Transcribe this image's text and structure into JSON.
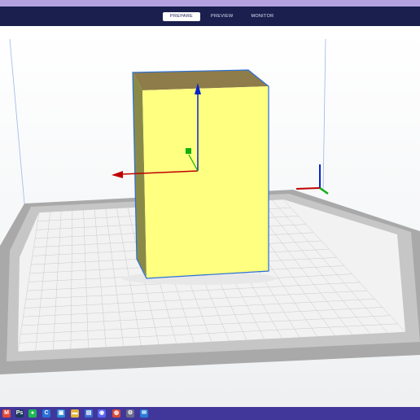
{
  "header": {
    "tabs": [
      {
        "label": "PREPARE",
        "active": true
      },
      {
        "label": "PREVIEW",
        "active": false
      },
      {
        "label": "MONITOR",
        "active": false
      }
    ]
  },
  "viewport": {
    "object_color": "#ffff80",
    "axis_colors": {
      "x": "#c00000",
      "y": "#0a24c8",
      "z": "#10b010"
    }
  },
  "taskbar": {
    "icons": [
      {
        "name": "gmail-icon",
        "glyph": "M",
        "color": "#e04a3a"
      },
      {
        "name": "photoshop-icon",
        "glyph": "Ps",
        "color": "#1c3a5a"
      },
      {
        "name": "spotify-icon",
        "glyph": "●",
        "color": "#1db954"
      },
      {
        "name": "cura-icon",
        "glyph": "C",
        "color": "#2a6fd6"
      },
      {
        "name": "monitor-app-icon",
        "glyph": "▣",
        "color": "#2a8ad6"
      },
      {
        "name": "file-explorer-icon",
        "glyph": "▬",
        "color": "#e3b53a"
      },
      {
        "name": "store-icon",
        "glyph": "▤",
        "color": "#3b6fd6"
      },
      {
        "name": "discord-icon",
        "glyph": "◉",
        "color": "#5865f2"
      },
      {
        "name": "chrome-icon",
        "glyph": "◍",
        "color": "#d64a3a"
      },
      {
        "name": "settings-icon",
        "glyph": "⚙",
        "color": "#6a6a8a"
      },
      {
        "name": "mail-icon",
        "glyph": "✉",
        "color": "#2a7ad6"
      }
    ]
  }
}
